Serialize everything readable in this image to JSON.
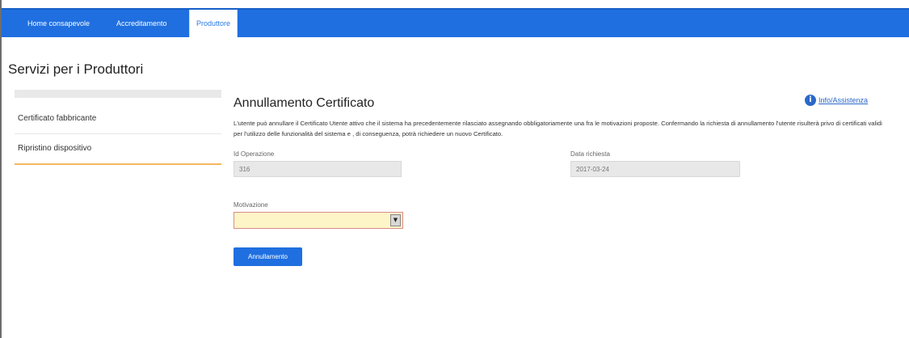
{
  "nav": {
    "tabs": [
      {
        "label": "Home consapevole"
      },
      {
        "label": "Accreditamento"
      },
      {
        "label": "Produttore"
      }
    ]
  },
  "page": {
    "title": "Servizi per i Produttori"
  },
  "sidebar": {
    "items": [
      {
        "label": "Certificato fabbricante"
      },
      {
        "label": "Ripristino dispositivo"
      }
    ]
  },
  "main": {
    "title": "Annullamento Certificato",
    "info_link": "Info/Assistenza",
    "description": "L'utente può annullare il Certificato Utente attivo che il sistema ha precedentemente rilasciato assegnando obbligatoriamente una fra le motivazioni proposte. Confermando la richiesta di annullamento l'utente risulterà privo di certificati validi per l'utilizzo delle funzionalità del sistema e , di conseguenza, potrà richiedere un nuovo Certificato.",
    "id_label": "Id Operazione",
    "id_value": "316",
    "date_label": "Data richiesta",
    "date_value": "2017-03-24",
    "motivazione_label": "Motivazione",
    "motivazione_value": "",
    "submit_label": "Annullamento"
  },
  "colors": {
    "topbar": "#1f6fe0",
    "accent": "#2a7ae2",
    "sidebar_underline": "#f3b760",
    "select_bg": "#fdf5c8"
  }
}
